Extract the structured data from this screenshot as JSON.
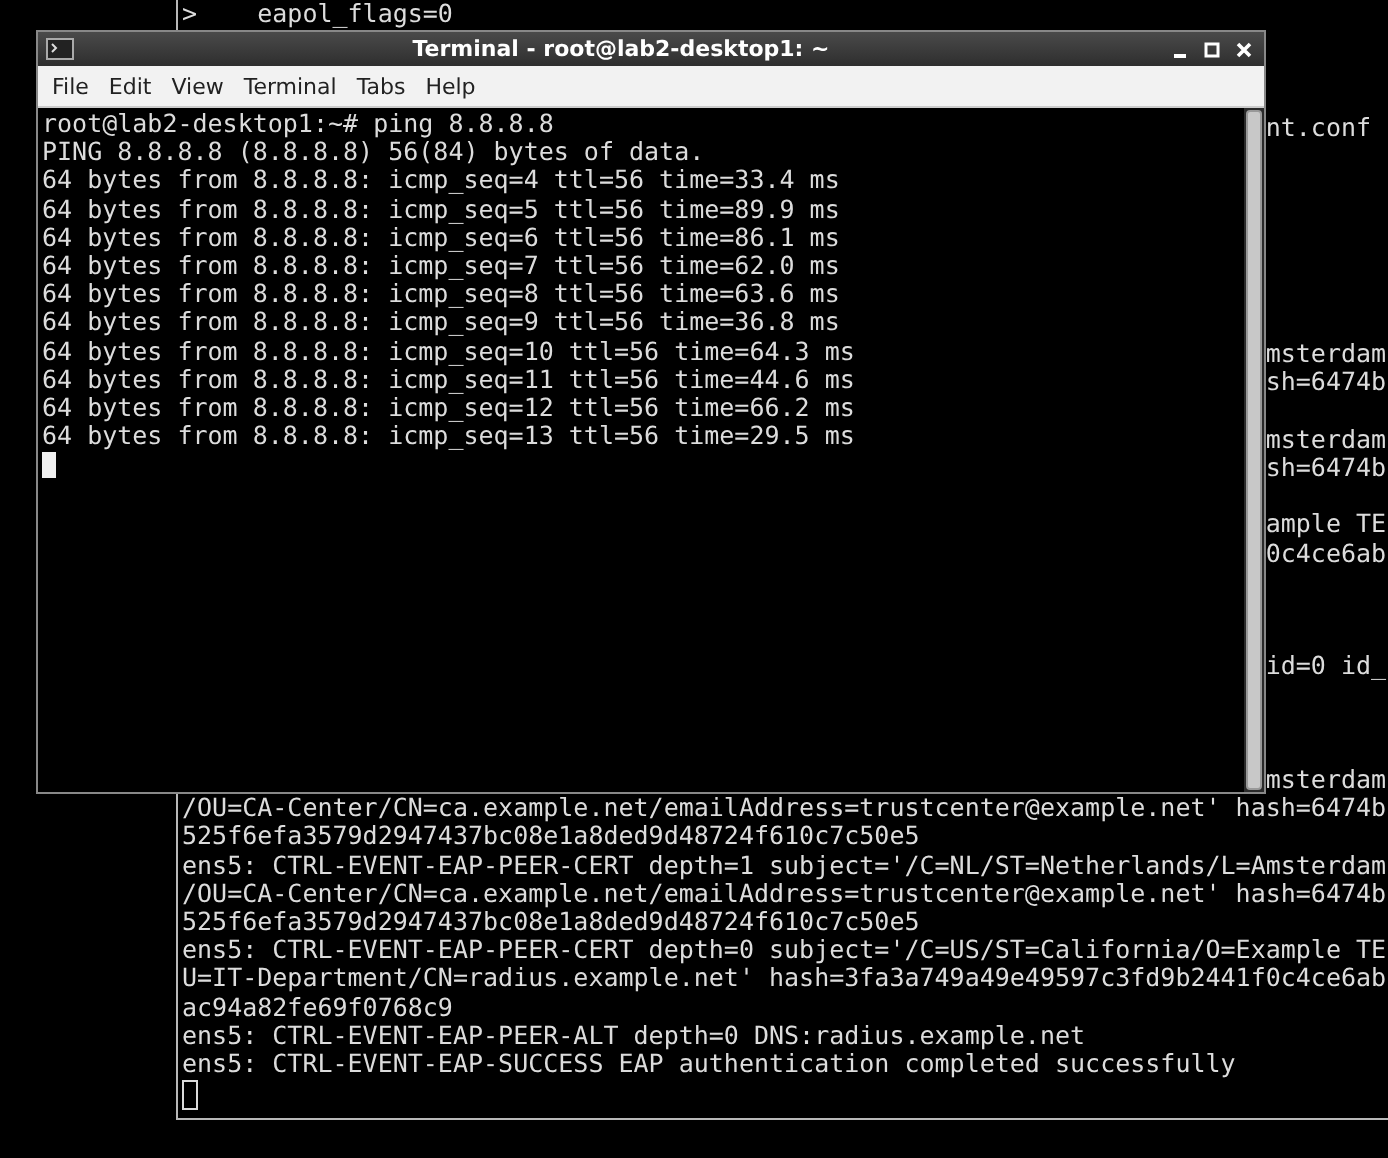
{
  "background_terminal": {
    "lines": [
      {
        "kind": "text",
        "left": ">    eapol_flags=0"
      },
      {
        "kind": "blank"
      },
      {
        "kind": "blank"
      },
      {
        "kind": "blank"
      },
      {
        "kind": "text",
        "right": "nt.conf"
      },
      {
        "kind": "blank"
      },
      {
        "kind": "blank"
      },
      {
        "kind": "blank"
      },
      {
        "kind": "blank"
      },
      {
        "kind": "blank"
      },
      {
        "kind": "blank"
      },
      {
        "kind": "blank"
      },
      {
        "kind": "text",
        "right": "msterdam"
      },
      {
        "kind": "text",
        "right": "sh=6474b"
      },
      {
        "kind": "blank"
      },
      {
        "kind": "text",
        "right": "msterdam"
      },
      {
        "kind": "text",
        "right": "sh=6474b"
      },
      {
        "kind": "blank"
      },
      {
        "kind": "text",
        "right": "ample TE"
      },
      {
        "kind": "text",
        "right": "0c4ce6ab"
      },
      {
        "kind": "blank"
      },
      {
        "kind": "blank"
      },
      {
        "kind": "blank"
      },
      {
        "kind": "text",
        "right": "id=0 id_"
      },
      {
        "kind": "blank"
      },
      {
        "kind": "blank"
      },
      {
        "kind": "blank"
      },
      {
        "kind": "text",
        "right": "msterdam"
      },
      {
        "kind": "text",
        "left": "/OU=CA-Center/CN=ca.example.net/emailAddress=trustcenter@example.net' hash=6474b"
      },
      {
        "kind": "text",
        "left": "525f6efa3579d2947437bc08e1a8ded9d48724f610c7c50e5"
      },
      {
        "kind": "text",
        "left": "ens5: CTRL-EVENT-EAP-PEER-CERT depth=1 subject='/C=NL/ST=Netherlands/L=Amsterdam"
      },
      {
        "kind": "text",
        "left": "/OU=CA-Center/CN=ca.example.net/emailAddress=trustcenter@example.net' hash=6474b"
      },
      {
        "kind": "text",
        "left": "525f6efa3579d2947437bc08e1a8ded9d48724f610c7c50e5"
      },
      {
        "kind": "text",
        "left": "ens5: CTRL-EVENT-EAP-PEER-CERT depth=0 subject='/C=US/ST=California/O=Example TE"
      },
      {
        "kind": "text",
        "left": "U=IT-Department/CN=radius.example.net' hash=3fa3a749a49e49597c3fd9b2441f0c4ce6ab"
      },
      {
        "kind": "text",
        "left": "ac94a82fe69f0768c9"
      },
      {
        "kind": "text",
        "left": "ens5: CTRL-EVENT-EAP-PEER-ALT depth=0 DNS:radius.example.net"
      },
      {
        "kind": "text",
        "left": "ens5: CTRL-EVENT-EAP-SUCCESS EAP authentication completed successfully"
      }
    ]
  },
  "window": {
    "title": "Terminal - root@lab2-desktop1: ~",
    "menu": [
      "File",
      "Edit",
      "View",
      "Terminal",
      "Tabs",
      "Help"
    ],
    "lines": [
      "root@lab2-desktop1:~# ping 8.8.8.8",
      "PING 8.8.8.8 (8.8.8.8) 56(84) bytes of data.",
      "64 bytes from 8.8.8.8: icmp_seq=4 ttl=56 time=33.4 ms",
      "64 bytes from 8.8.8.8: icmp_seq=5 ttl=56 time=89.9 ms",
      "64 bytes from 8.8.8.8: icmp_seq=6 ttl=56 time=86.1 ms",
      "64 bytes from 8.8.8.8: icmp_seq=7 ttl=56 time=62.0 ms",
      "64 bytes from 8.8.8.8: icmp_seq=8 ttl=56 time=63.6 ms",
      "64 bytes from 8.8.8.8: icmp_seq=9 ttl=56 time=36.8 ms",
      "64 bytes from 8.8.8.8: icmp_seq=10 ttl=56 time=64.3 ms",
      "64 bytes from 8.8.8.8: icmp_seq=11 ttl=56 time=44.6 ms",
      "64 bytes from 8.8.8.8: icmp_seq=12 ttl=56 time=66.2 ms",
      "64 bytes from 8.8.8.8: icmp_seq=13 ttl=56 time=29.5 ms"
    ]
  }
}
